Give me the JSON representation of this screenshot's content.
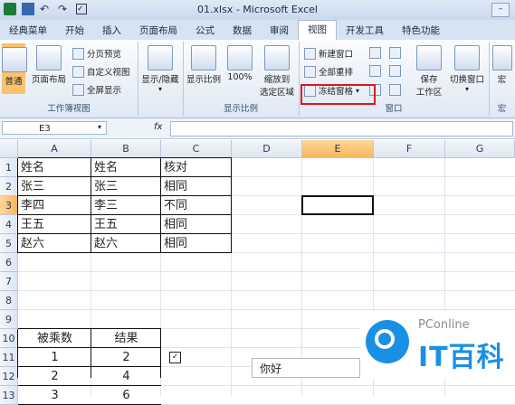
{
  "window": {
    "title": "01.xlsx - Microsoft Excel"
  },
  "tabs": [
    "经典菜单",
    "开始",
    "插入",
    "页面布局",
    "公式",
    "数据",
    "审阅",
    "视图",
    "开发工具",
    "特色功能"
  ],
  "active_tab": "视图",
  "ribbon": {
    "workbook_views": {
      "label": "工作簿视图",
      "normal": "普通",
      "page_layout": "页面布局",
      "page_break": "分页预览",
      "custom": "自定义视图",
      "fullscreen": "全屏显示"
    },
    "show": {
      "label": "显示/隐藏"
    },
    "zoom": {
      "label": "显示比例",
      "zoom": "显示比例",
      "hundred": "100%",
      "fit_line1": "缩放到",
      "fit_line2": "选定区域"
    },
    "window": {
      "label": "窗口",
      "new_window": "新建窗口",
      "arrange_all": "全部重排",
      "freeze_panes": "冻结窗格",
      "save_line1": "保存",
      "save_line2": "工作区",
      "switch": "切换窗口"
    },
    "macro": {
      "label": "宏"
    }
  },
  "formula_bar": {
    "name_box": "E3",
    "fx": "fx",
    "value": ""
  },
  "columns": [
    "A",
    "B",
    "C",
    "D",
    "E",
    "F",
    "G"
  ],
  "rows": [
    "1",
    "2",
    "3",
    "4",
    "5",
    "6",
    "7",
    "8",
    "9",
    "10",
    "11",
    "12",
    "13"
  ],
  "cells": {
    "A1": "姓名",
    "B1": "姓名",
    "C1": "核对",
    "A2": "张三",
    "B2": "张三",
    "C2": "相同",
    "A3": "李四",
    "B3": "李三",
    "C3": "不同",
    "A4": "王五",
    "B4": "王五",
    "C4": "相同",
    "A5": "赵六",
    "B5": "赵六",
    "C5": "相同",
    "A10": "被乘数",
    "B10": "结果",
    "A11": "1",
    "B11": "2",
    "A12": "2",
    "B12": "4",
    "A13": "3",
    "B13": "6"
  },
  "active_cell": "E3",
  "popup_text": "你好",
  "watermark": {
    "small": "PConline",
    "big": "IT百科"
  },
  "colors": {
    "highlight": "#e2141a",
    "selected_header": "#f8b65a",
    "watermark_blue": "#1a8fe6"
  }
}
